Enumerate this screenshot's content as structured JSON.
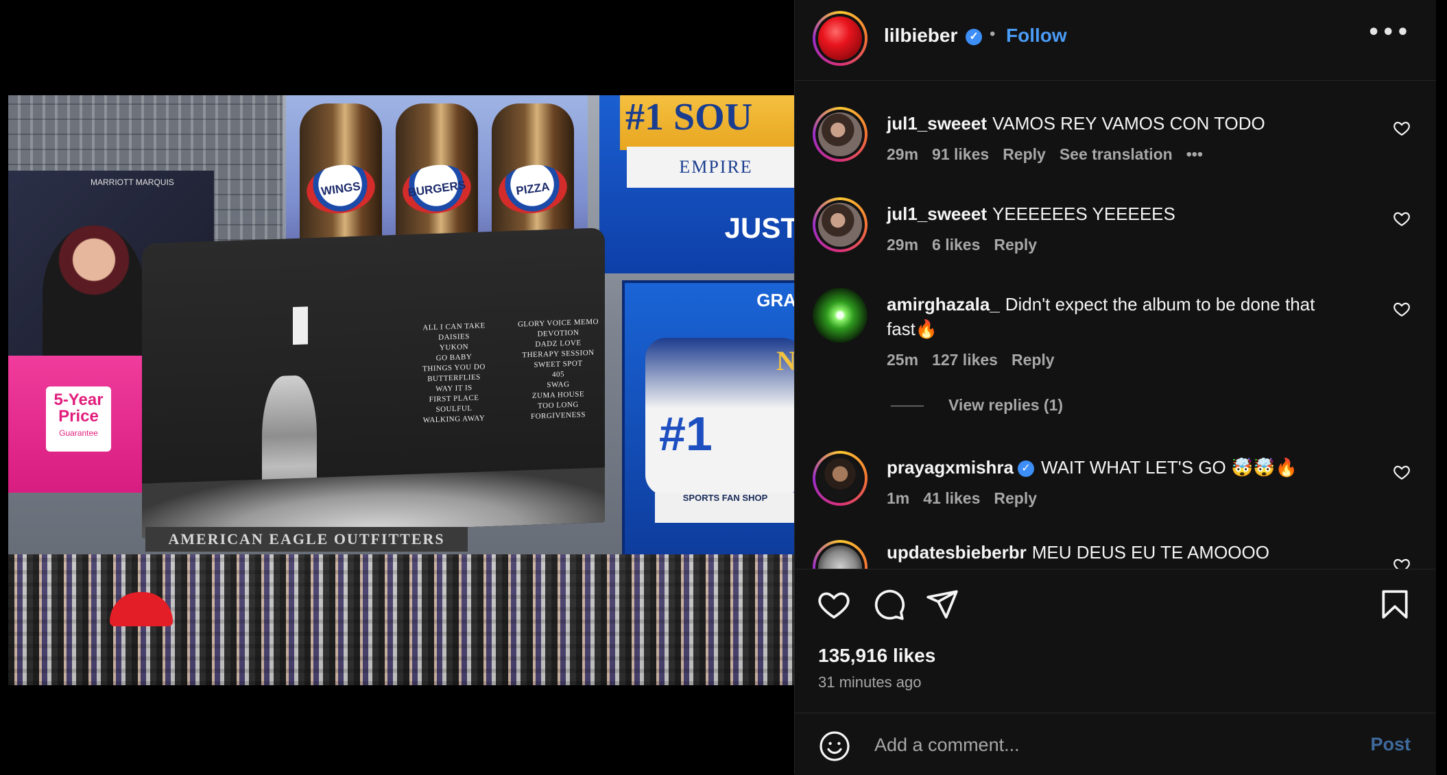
{
  "post": {
    "username": "lilbieber",
    "verified_glyph": "✓",
    "separator": "•",
    "follow_label": "Follow",
    "more_label": "•••",
    "likes": "135,916 likes",
    "time_ago": "31 minutes ago",
    "icons": {
      "like": "heart-icon",
      "comment": "comment-icon",
      "share": "paper-plane-icon",
      "save": "bookmark-icon",
      "more": "more-horizontal-icon",
      "emoji": "emoji-icon"
    }
  },
  "photo": {
    "can_labels": [
      "WINGS",
      "BURGERS",
      "PIZZA"
    ],
    "empire_big": "#1 SOU",
    "empire_sub": "EMPIRE",
    "empire_just": "JUST",
    "right_gra": "GRA",
    "right_n": "N",
    "right_num": "#1",
    "marriott": "MARRIOTT MARQUIS",
    "price_card": {
      "line1": "5-Year",
      "line2": "Price",
      "line3": "Guarantee"
    },
    "tracklist_left": [
      "ALL I CAN TAKE",
      "DAISIES",
      "YUKON",
      "GO BABY",
      "THINGS YOU DO",
      "BUTTERFLIES",
      "WAY IT IS",
      "FIRST PLACE",
      "SOULFUL",
      "WALKING AWAY"
    ],
    "tracklist_right": [
      "GLORY VOICE MEMO",
      "DEVOTION",
      "DADZ LOVE",
      "THERAPY SESSION",
      "SWEET SPOT",
      "405",
      "SWAG",
      "ZUMA HOUSE",
      "TOO LONG",
      "FORGIVENESS"
    ],
    "store_band": "AMERICAN EAGLE OUTFITTERS",
    "sports_shop": "SPORTS FAN SHOP"
  },
  "comments": [
    {
      "user": "jul1_sweeet",
      "verified": false,
      "text": "VAMOS REY VAMOS CON TODO",
      "time": "29m",
      "likes": "91 likes",
      "reply": "Reply",
      "translate": "See translation",
      "more": "•••"
    },
    {
      "user": "jul1_sweeet",
      "verified": false,
      "text": "YEEEEEES YEEEEES",
      "time": "29m",
      "likes": "6 likes",
      "reply": "Reply"
    },
    {
      "user": "amirghazala_",
      "verified": false,
      "text": "Didn't expect the album to be done that fast🔥",
      "time": "25m",
      "likes": "127 likes",
      "reply": "Reply",
      "view_replies": "View replies (1)"
    },
    {
      "user": "prayagxmishra",
      "verified": true,
      "text": "WAIT WHAT LET'S GO 🤯🤯🔥",
      "time": "1m",
      "likes": "41 likes",
      "reply": "Reply"
    },
    {
      "user": "updatesbieberbr",
      "verified": false,
      "text": "MEU DEUS EU TE AMOOOO"
    }
  ],
  "composer": {
    "placeholder": "Add a comment...",
    "post_label": "Post"
  },
  "colors": {
    "accent": "#4a9cf7",
    "panel": "#121212",
    "muted": "#a8a8a8",
    "post_disabled": "#3f6a9c"
  }
}
